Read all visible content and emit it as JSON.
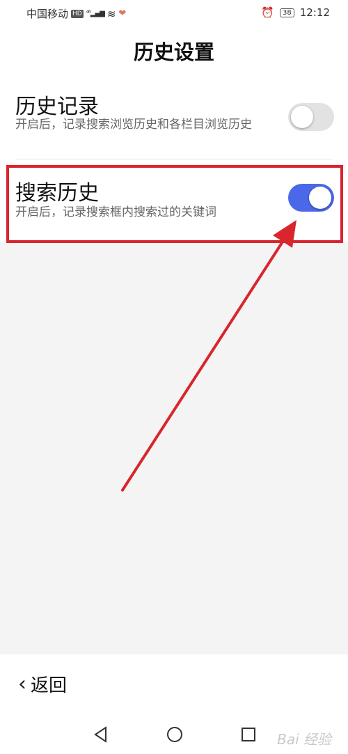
{
  "status_bar": {
    "carrier": "中国移动",
    "hd": "HD",
    "network": "⁴⁶",
    "battery": "38",
    "time": "12:12"
  },
  "header": {
    "title": "历史设置"
  },
  "settings": [
    {
      "title": "历史记录",
      "description": "开启后，记录搜索浏览历史和各栏目浏览历史",
      "enabled": false
    },
    {
      "title": "搜索历史",
      "description": "开启后，记录搜索框内搜索过的关键词",
      "enabled": true
    }
  ],
  "footer": {
    "back_label": "返回"
  },
  "watermark": "Bai 经验",
  "colors": {
    "toggle_on": "#4a68e8",
    "toggle_off": "#e2e2e2",
    "annotation": "#d9252e"
  }
}
